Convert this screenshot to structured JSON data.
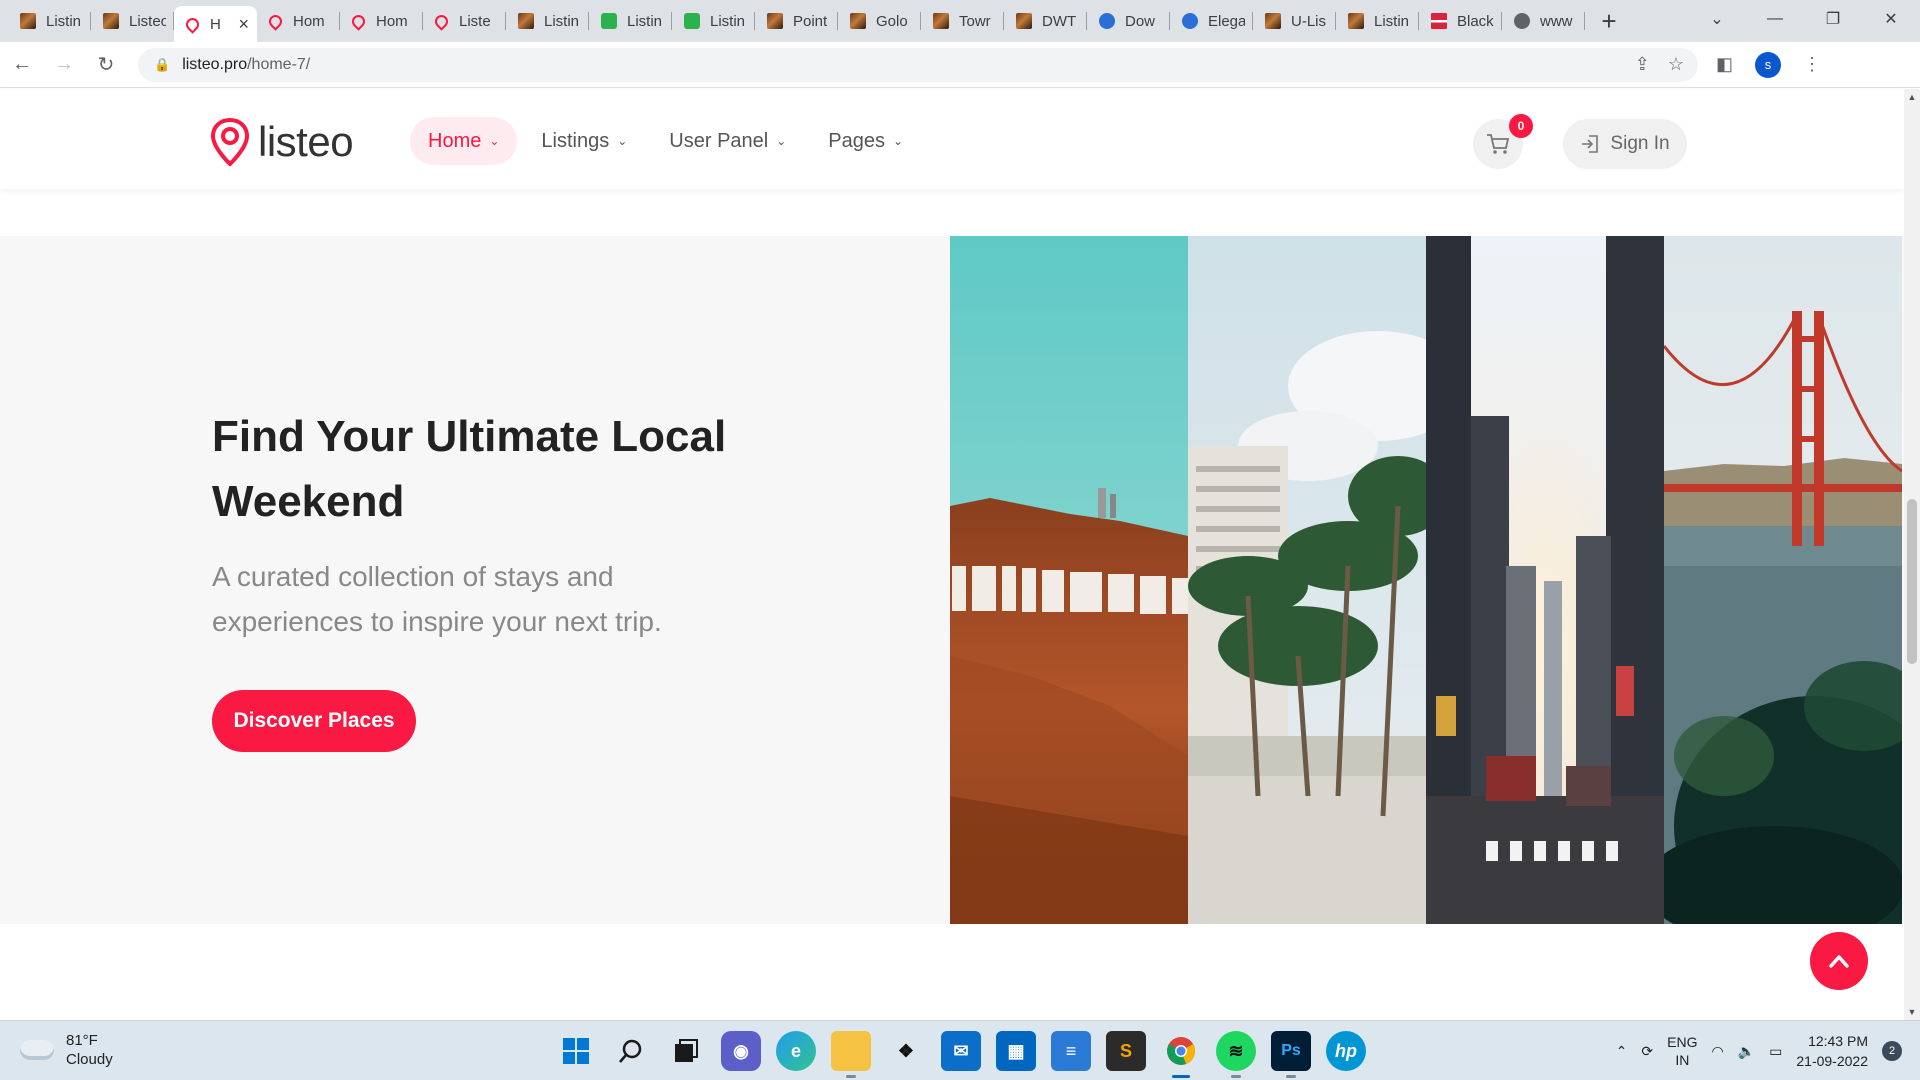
{
  "browser": {
    "tabs": [
      {
        "label": "Listin",
        "favicon": "book-favicon"
      },
      {
        "label": "Listeo",
        "favicon": "book-favicon"
      },
      {
        "label": "H",
        "favicon": "pin-favicon",
        "active": true
      },
      {
        "label": "Hom",
        "favicon": "pin-favicon"
      },
      {
        "label": "Hom",
        "favicon": "pin-favicon"
      },
      {
        "label": "Liste",
        "favicon": "pin-favicon"
      },
      {
        "label": "Listin",
        "favicon": "book-favicon"
      },
      {
        "label": "Listin",
        "favicon": "leaf-favicon"
      },
      {
        "label": "Listin",
        "favicon": "leaf-favicon"
      },
      {
        "label": "Point",
        "favicon": "book-favicon"
      },
      {
        "label": "Golo",
        "favicon": "book-favicon"
      },
      {
        "label": "Towr",
        "favicon": "book-favicon"
      },
      {
        "label": "DWT",
        "favicon": "book-favicon"
      },
      {
        "label": "Dow",
        "favicon": "blue-favicon"
      },
      {
        "label": "Elega",
        "favicon": "blue-favicon"
      },
      {
        "label": "U-Lis",
        "favicon": "book-favicon"
      },
      {
        "label": "Listin",
        "favicon": "book-favicon"
      },
      {
        "label": "Black",
        "favicon": "flag-favicon"
      },
      {
        "label": "www",
        "favicon": "globe-favicon"
      }
    ],
    "url_host": "listeo.pro",
    "url_path": "/home-7/",
    "profile_initial": "s"
  },
  "site": {
    "logo_text": "listeo",
    "nav": [
      {
        "label": "Home",
        "active": true
      },
      {
        "label": "Listings"
      },
      {
        "label": "User Panel"
      },
      {
        "label": "Pages"
      }
    ],
    "cart_count": "0",
    "signin_label": "Sign In",
    "accent_color": "#f91942"
  },
  "hero": {
    "title": "Find Your Ultimate Local Weekend",
    "subtitle": "A curated collection of stays and experiences to inspire your next trip.",
    "cta_label": "Discover Places",
    "images": [
      "hollywood-sign-hills",
      "palm-trees-beach",
      "city-street-skyscrapers",
      "golden-gate-bridge"
    ]
  },
  "taskbar": {
    "weather_temp": "81°F",
    "weather_desc": "Cloudy",
    "lang_top": "ENG",
    "lang_bottom": "IN",
    "time": "12:43 PM",
    "date": "21-09-2022",
    "notifications": "2",
    "apps": [
      "start",
      "search",
      "task-view",
      "teams-chat",
      "edge",
      "file-explorer",
      "dropbox",
      "mail",
      "store",
      "notepad",
      "sublime-text",
      "chrome",
      "spotify",
      "photoshop",
      "hp"
    ]
  }
}
